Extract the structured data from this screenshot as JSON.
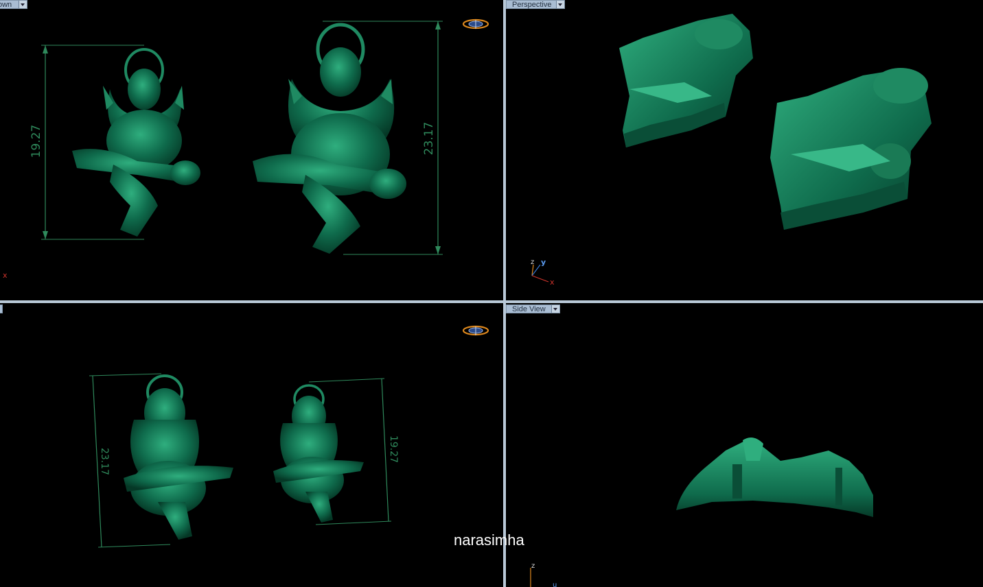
{
  "viewports": {
    "top_left": {
      "label": "own",
      "dimensions": [
        "19.27",
        "23.17"
      ],
      "axis_label": "x"
    },
    "top_right": {
      "label": "Perspective",
      "axis_labels": [
        "z",
        "y",
        "x"
      ]
    },
    "bottom_left": {
      "label": "",
      "dimensions": [
        "23.17",
        "19.27"
      ]
    },
    "bottom_right": {
      "label": "Side View",
      "axis_labels": [
        "z",
        "u"
      ]
    }
  },
  "caption": "narasimha",
  "icons": {
    "nav_widget": "view-navigation-icon",
    "dropdown": "chevron-down-icon",
    "axis_tripod": "axis-tripod-icon"
  },
  "colors": {
    "model": "#0f6b4c",
    "model_highlight": "#2fae7e",
    "dimension_line": "#2f8a5c",
    "viewport_label_bg": "#a9bdd3",
    "divider": "#b9c9d8",
    "background": "#000000"
  }
}
